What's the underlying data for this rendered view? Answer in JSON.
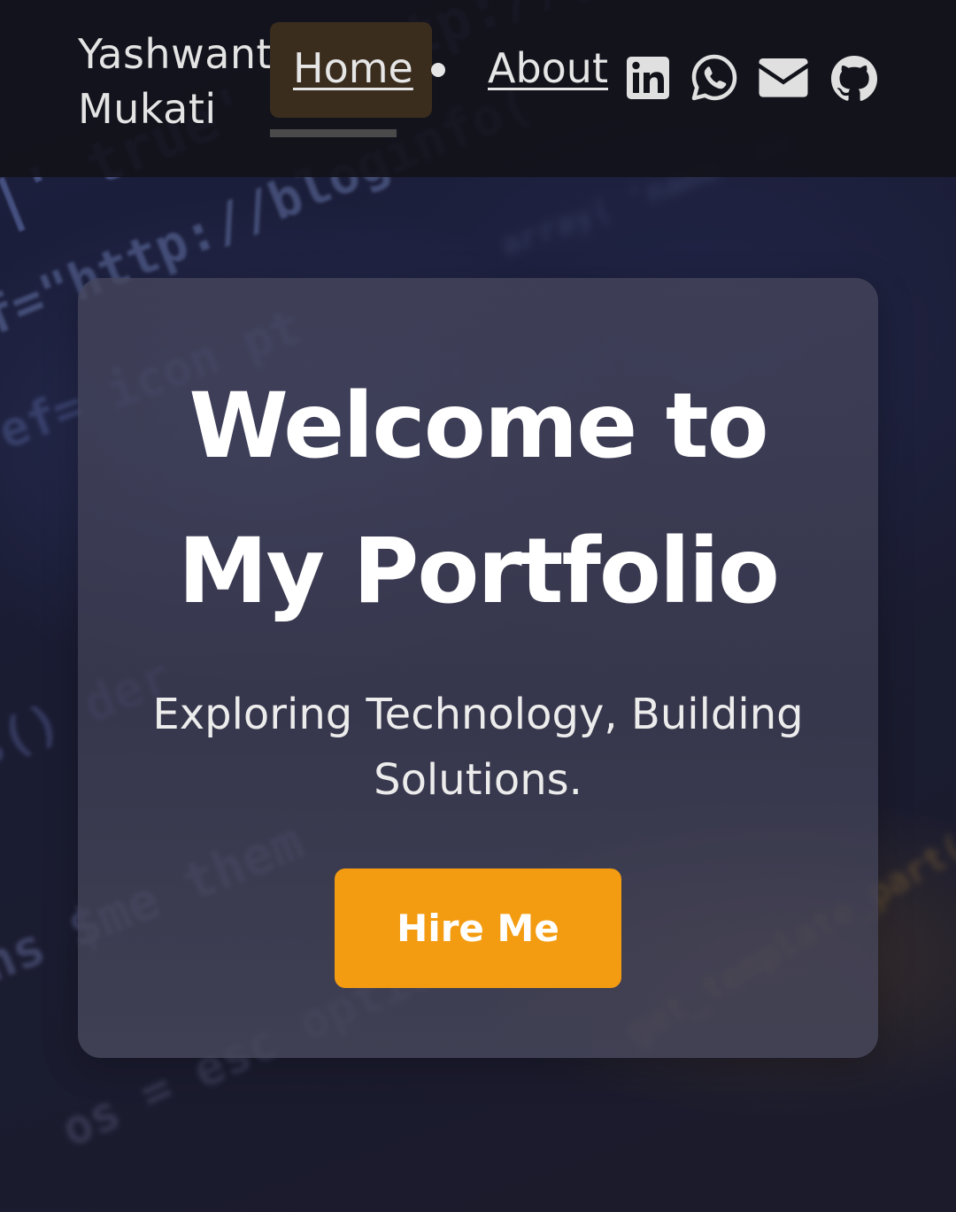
{
  "navbar": {
    "brand_line1": "Yashwant",
    "brand_line2": "Mukati",
    "links": [
      {
        "label": "Home",
        "active": true
      },
      {
        "label": "About",
        "active": false
      }
    ],
    "social_icons": [
      "linkedin-icon",
      "whatsapp-icon",
      "mail-icon",
      "github-icon"
    ]
  },
  "hero": {
    "title_line1": "Welcome to",
    "title_line2": "My Portfolio",
    "subtitle": "Exploring Technology, Building Solutions.",
    "cta_label": "Hire Me"
  },
  "colors": {
    "accent": "#f39c12",
    "nav_bg": "#12121a",
    "active_link_bg": "#3a2d1e",
    "icon": "#e0e0e0"
  }
}
